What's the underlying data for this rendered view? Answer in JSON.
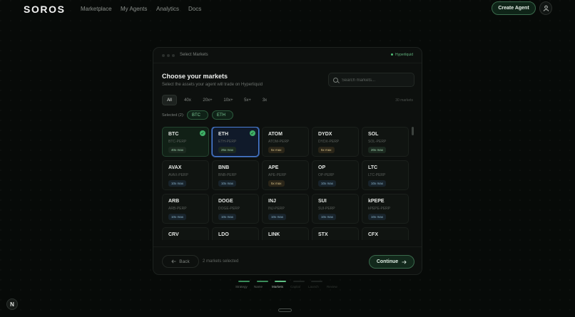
{
  "nav": {
    "logo": "SOROS",
    "links": [
      "Marketplace",
      "My Agents",
      "Analytics",
      "Docs"
    ],
    "create_label": "Create Agent"
  },
  "modal": {
    "window_title": "Select Markets",
    "status": "Hyperliquid",
    "title": "Choose your markets",
    "subtitle": "Select the assets your agent will trade on Hyperliquid",
    "search_placeholder": "Search markets...",
    "filters": [
      "All",
      "40x",
      "20x+",
      "10x+",
      "5x+",
      "3x"
    ],
    "market_count": "30 markets",
    "selected_label": "Selected (2):",
    "selected_chips": [
      "BTC",
      "ETH"
    ],
    "markets": [
      {
        "symbol": "BTC",
        "pair": "BTC-PERP",
        "leverage": "40x max",
        "tier": "hi",
        "selected": true
      },
      {
        "symbol": "ETH",
        "pair": "ETH-PERP",
        "leverage": "25x max",
        "tier": "hi",
        "selected": true
      },
      {
        "symbol": "ATOM",
        "pair": "ATOM-PERP",
        "leverage": "5x max",
        "tier": "mid",
        "selected": false
      },
      {
        "symbol": "DYDX",
        "pair": "DYDX-PERP",
        "leverage": "5x max",
        "tier": "mid",
        "selected": false
      },
      {
        "symbol": "SOL",
        "pair": "SOL-PERP",
        "leverage": "20x max",
        "tier": "hi",
        "selected": false
      },
      {
        "symbol": "AVAX",
        "pair": "AVAX-PERP",
        "leverage": "10x max",
        "tier": "lo",
        "selected": false
      },
      {
        "symbol": "BNB",
        "pair": "BNB-PERP",
        "leverage": "10x max",
        "tier": "lo",
        "selected": false
      },
      {
        "symbol": "APE",
        "pair": "APE-PERP",
        "leverage": "5x max",
        "tier": "mid",
        "selected": false
      },
      {
        "symbol": "OP",
        "pair": "OP-PERP",
        "leverage": "10x max",
        "tier": "lo",
        "selected": false
      },
      {
        "symbol": "LTC",
        "pair": "LTC-PERP",
        "leverage": "10x max",
        "tier": "lo",
        "selected": false
      },
      {
        "symbol": "ARB",
        "pair": "ARB-PERP",
        "leverage": "10x max",
        "tier": "lo",
        "selected": false
      },
      {
        "symbol": "DOGE",
        "pair": "DOGE-PERP",
        "leverage": "10x max",
        "tier": "lo",
        "selected": false
      },
      {
        "symbol": "INJ",
        "pair": "INJ-PERP",
        "leverage": "10x max",
        "tier": "lo",
        "selected": false
      },
      {
        "symbol": "SUI",
        "pair": "SUI-PERP",
        "leverage": "10x max",
        "tier": "lo",
        "selected": false
      },
      {
        "symbol": "kPEPE",
        "pair": "kPEPE-PERP",
        "leverage": "10x max",
        "tier": "lo",
        "selected": false
      },
      {
        "symbol": "CRV",
        "pair": "",
        "leverage": "",
        "tier": "lo",
        "selected": false
      },
      {
        "symbol": "LDO",
        "pair": "",
        "leverage": "",
        "tier": "lo",
        "selected": false
      },
      {
        "symbol": "LINK",
        "pair": "",
        "leverage": "",
        "tier": "lo",
        "selected": false
      },
      {
        "symbol": "STX",
        "pair": "",
        "leverage": "",
        "tier": "lo",
        "selected": false
      },
      {
        "symbol": "CFX",
        "pair": "",
        "leverage": "",
        "tier": "lo",
        "selected": false
      }
    ],
    "back_label": "Back",
    "selected_count": "2 markets selected",
    "continue_label": "Continue"
  },
  "steps": [
    {
      "label": "Strategy",
      "state": "done"
    },
    {
      "label": "Name",
      "state": "done"
    },
    {
      "label": "Markets",
      "state": "current"
    },
    {
      "label": "Capital",
      "state": "todo"
    },
    {
      "label": "Launch",
      "state": "todo"
    },
    {
      "label": "Review",
      "state": "todo"
    }
  ],
  "corner_badge": "N"
}
